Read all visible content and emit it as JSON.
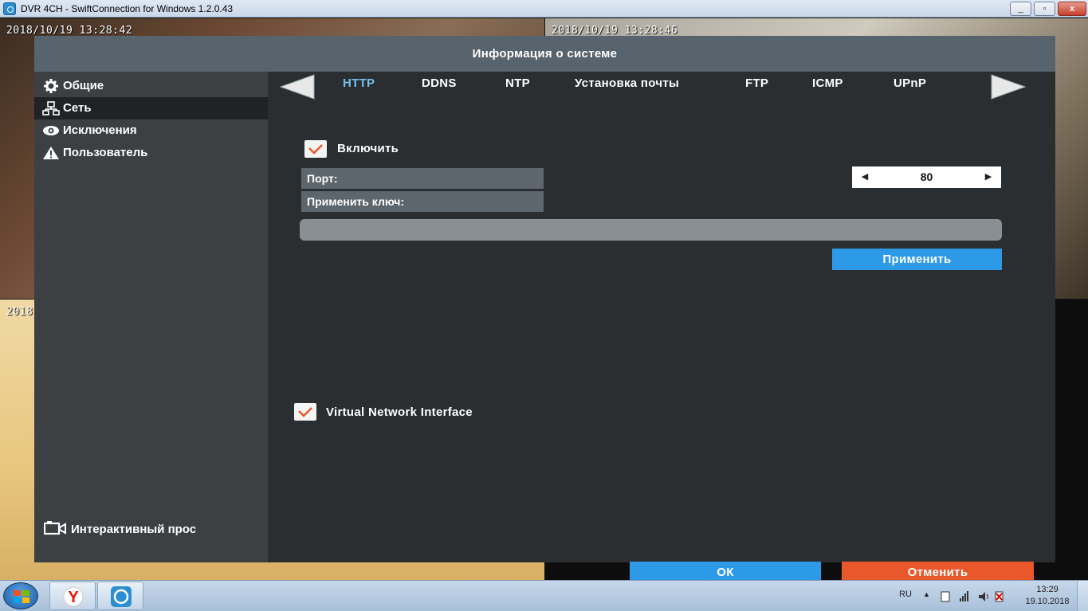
{
  "window": {
    "title": "DVR 4CH - SwiftConnection for Windows 1.2.0.43",
    "minimize": "_",
    "maximize": "▫",
    "close": "x"
  },
  "cameras": {
    "cam1_time": "2018/10/19 13:28:42",
    "cam2_time": "2018/10/19 13:28:46",
    "cam3_time": "2018"
  },
  "dialog": {
    "title": "Информация о системе"
  },
  "sidebar": {
    "items": [
      {
        "label": "Общие",
        "icon": "gear-icon"
      },
      {
        "label": "Сеть",
        "icon": "network-icon"
      },
      {
        "label": "Исключения",
        "icon": "eye-icon"
      },
      {
        "label": "Пользователь",
        "icon": "warning-icon"
      }
    ],
    "active_index": 1,
    "bottom_label": "Интерактивный прос"
  },
  "tabs": [
    "HTTP",
    "DDNS",
    "NTP",
    "Установка почты",
    "FTP",
    "ICMP",
    "UPnP"
  ],
  "active_tab": "HTTP",
  "http": {
    "enable_label": "Включить",
    "enable_checked": true,
    "port_label": "Порт:",
    "port_value": "80",
    "apply_key_label": "Применить ключ:",
    "apply_key_value": "",
    "apply_button": "Применить",
    "vni_label": "Virtual Network Interface",
    "vni_checked": true
  },
  "footer": {
    "ok": "ОК",
    "cancel": "Отменить"
  },
  "taskbar": {
    "language": "RU",
    "time": "13:29",
    "date": "19.10.2018"
  },
  "colors": {
    "accent_blue": "#2d9ae8",
    "accent_orange": "#e8582a",
    "active_tab": "#78bff0",
    "header": "#57636d",
    "panel": "#2a2e31",
    "sidebar": "#3c4043"
  }
}
